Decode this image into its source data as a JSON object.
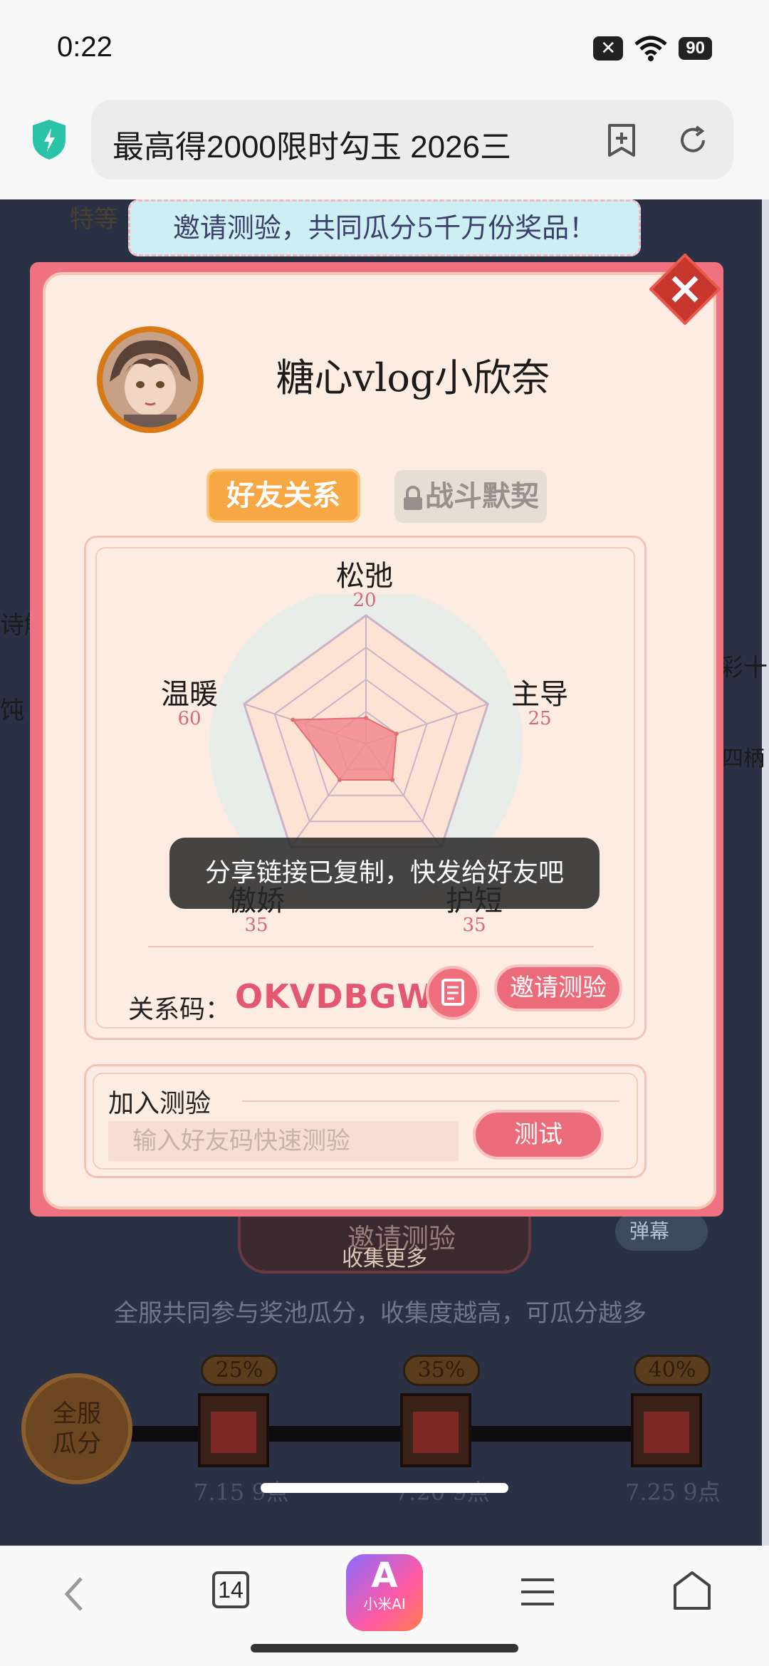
{
  "status_bar": {
    "time": "0:22",
    "battery": "90"
  },
  "browser": {
    "url_title": "最高得2000限时勾玉 2026三",
    "tab_count": "14",
    "ai_label": "小米AI",
    "ai_logo": "A"
  },
  "game_bg": {
    "banner": "邀请测验，共同瓜分5千万份奖品！",
    "side_text_left_1": "诗解",
    "side_text_left_2": "饨",
    "side_text_right_1": "彩十",
    "side_text_right_2": "四柄",
    "corner_text": "特等",
    "invite_button": "邀请测验",
    "invite_sub": "收集更多",
    "danmu": "弹幕",
    "pool_text": "全服共同参与奖池瓜分，收集度越高，可瓜分越多",
    "pool_circle": "全服\n瓜分",
    "milestones": [
      {
        "pct": "25%",
        "date": "7.15 9点"
      },
      {
        "pct": "35%",
        "date": "7.20 9点"
      },
      {
        "pct": "40%",
        "date": "7.25 9点"
      }
    ]
  },
  "modal": {
    "username": "糖心vlog小欣奈",
    "tabs": [
      {
        "label": "好友关系"
      },
      {
        "label": "战斗默契"
      }
    ],
    "radar": {
      "axes": [
        {
          "label": "松弛",
          "value": 20
        },
        {
          "label": "主导",
          "value": 25
        },
        {
          "label": "护短",
          "value": 35
        },
        {
          "label": "傲娇",
          "value": 35
        },
        {
          "label": "温暖",
          "value": 60
        }
      ],
      "max": 100
    },
    "code_label": "关系码：",
    "code_value": "OKVDBGWY",
    "invite_button": "邀请测验",
    "join_title": "加入测验",
    "join_placeholder": "输入好友码快速测验",
    "test_button": "测试"
  },
  "toast": "分享链接已复制，快发给好友吧",
  "colors": {
    "accent": "#ec6b7a",
    "tab_active": "#f7a744",
    "radar_fill": "#f28a8f"
  }
}
